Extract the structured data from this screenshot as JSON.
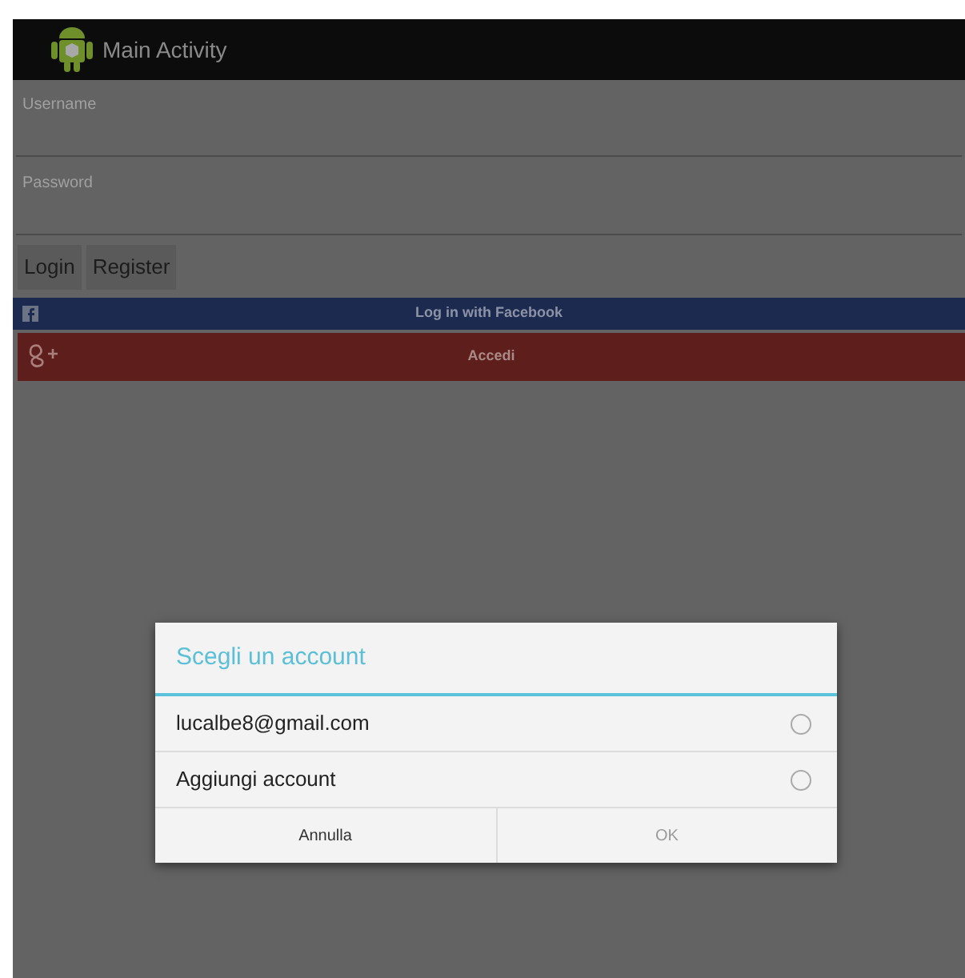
{
  "action_bar": {
    "title": "Main Activity"
  },
  "fields": [
    {
      "placeholder": "Username"
    },
    {
      "placeholder": "Password"
    }
  ],
  "buttons": [
    "Login",
    "Register"
  ],
  "facebook_button": {
    "label": "Log in with Facebook"
  },
  "google_button": {
    "label": "Accedi"
  },
  "dialog": {
    "title": "Scegli un account",
    "options": [
      {
        "label": "lucalbe8@gmail.com",
        "selected": false
      },
      {
        "label": "Aggiungi account",
        "selected": false
      }
    ],
    "actions": [
      {
        "label": "Annulla",
        "disabled": false
      },
      {
        "label": "OK",
        "disabled": true
      }
    ]
  }
}
